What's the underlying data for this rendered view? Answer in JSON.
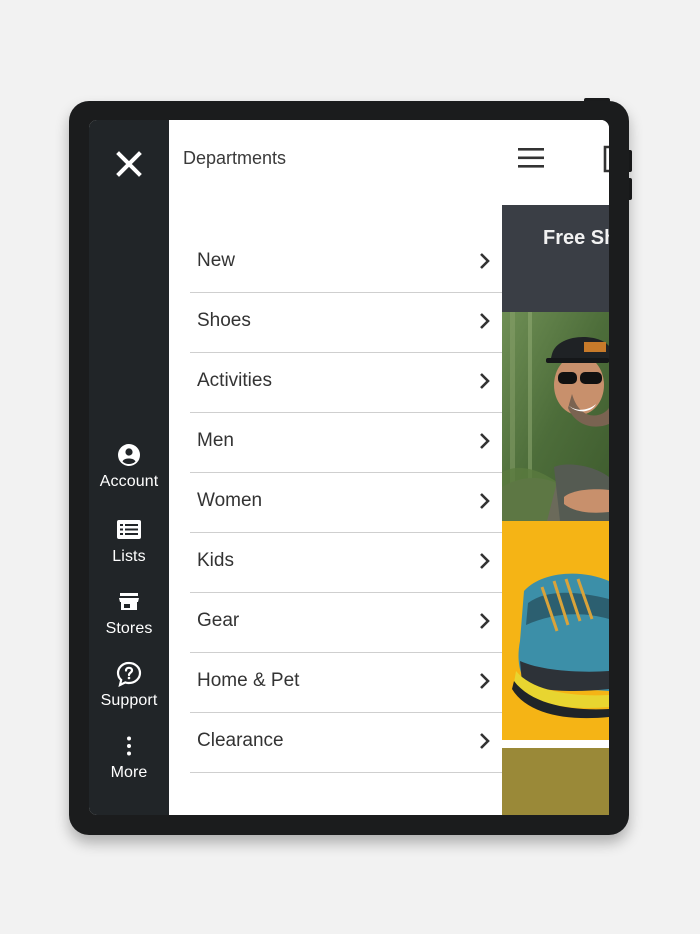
{
  "rail": {
    "close_icon": "close-icon",
    "items": [
      {
        "label": "Account",
        "icon": "account-circle-icon"
      },
      {
        "label": "Lists",
        "icon": "list-icon"
      },
      {
        "label": "Stores",
        "icon": "store-icon"
      },
      {
        "label": "Support",
        "icon": "support-help-icon"
      },
      {
        "label": "More",
        "icon": "more-vertical-icon"
      }
    ]
  },
  "menu": {
    "title": "Departments",
    "items": [
      {
        "label": "New"
      },
      {
        "label": "Shoes"
      },
      {
        "label": "Activities"
      },
      {
        "label": "Men"
      },
      {
        "label": "Women"
      },
      {
        "label": "Kids"
      },
      {
        "label": "Gear"
      },
      {
        "label": "Home & Pet"
      },
      {
        "label": "Clearance"
      }
    ]
  },
  "page": {
    "banner_text": "Free Sh",
    "hamburger_icon": "hamburger-menu-icon",
    "scan_icon": "barcode-scan-icon"
  },
  "colors": {
    "rail_bg": "#212528",
    "banner_bg": "#3a3e45",
    "shoe_bg": "#f5b415",
    "device": "#1b1c1d"
  }
}
